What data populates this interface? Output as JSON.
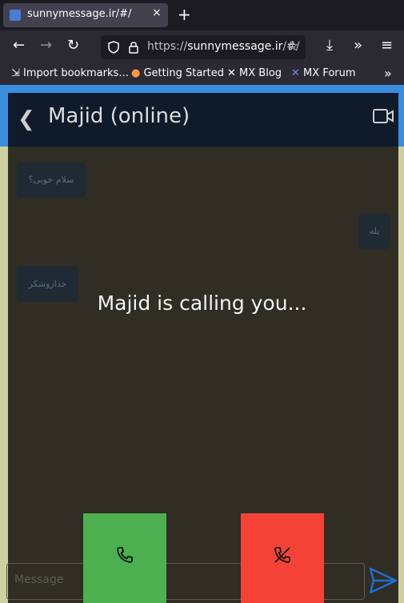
{
  "browser": {
    "tab_title": "sunnymessage.ir/#/",
    "tab_close": "×",
    "new_tab": "+",
    "url_prefix": "https://",
    "url_host": "sunnymessage.ir",
    "url_suffix": "/#/",
    "bookmarks": [
      {
        "label": "Import bookmarks…"
      },
      {
        "label": "Getting Started"
      },
      {
        "label": "MX Blog"
      },
      {
        "label": "MX Forum"
      }
    ]
  },
  "app": {
    "title": "Majid (online)",
    "messages": [
      {
        "text": "سلام خوبی؟",
        "side": "left"
      },
      {
        "text": "بله",
        "side": "right"
      },
      {
        "text": "خداروشکر",
        "side": "left"
      }
    ],
    "call_text": "Majid is calling you...",
    "input_placeholder": "Message"
  },
  "colors": {
    "accept": "#4caf50",
    "decline": "#f44336",
    "appbar": "#0f1a2a",
    "accent": "#3a8ee0"
  }
}
